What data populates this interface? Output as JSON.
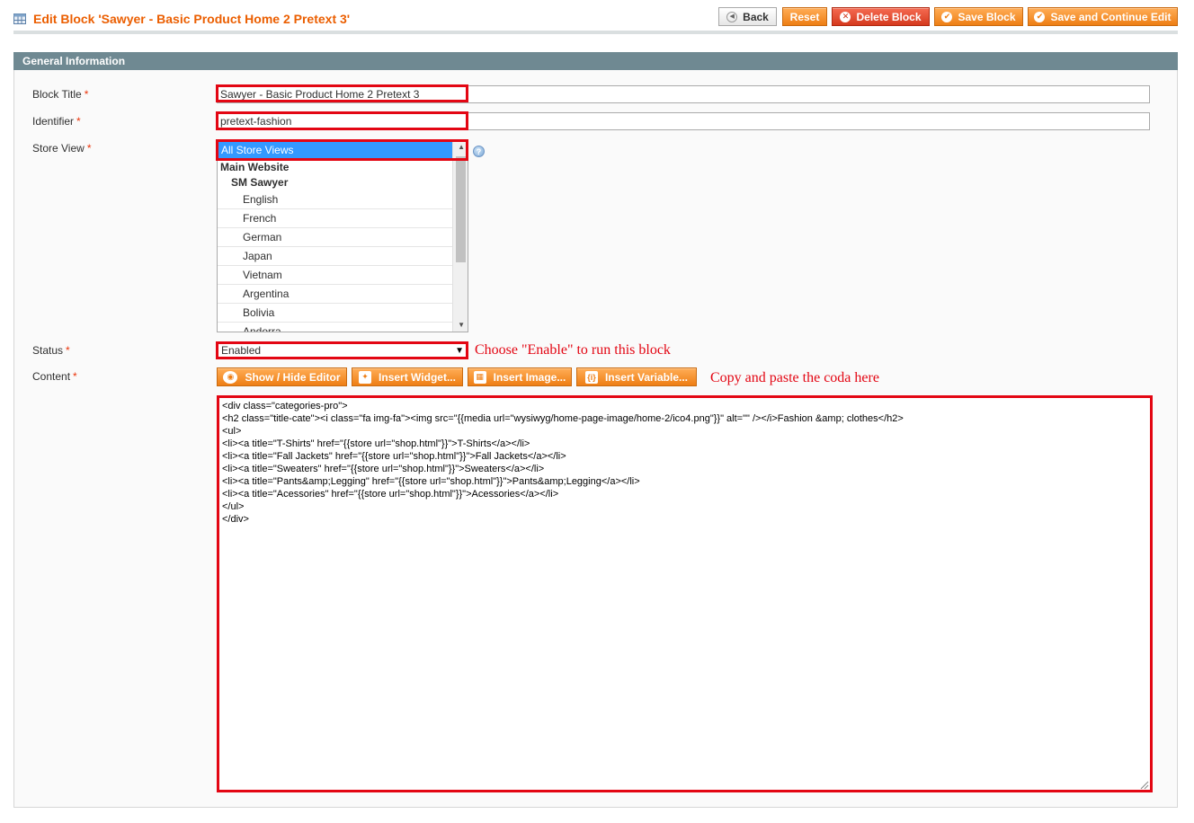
{
  "header": {
    "title": "Edit Block 'Sawyer - Basic Product Home 2 Pretext 3'",
    "buttons": {
      "back": "Back",
      "reset": "Reset",
      "delete": "Delete Block",
      "save": "Save Block",
      "save_continue": "Save and Continue Edit"
    }
  },
  "section": {
    "title": "General Information"
  },
  "form": {
    "block_title": {
      "label": "Block Title",
      "required": "*",
      "value": "Sawyer - Basic Product Home 2 Pretext 3"
    },
    "identifier": {
      "label": "Identifier",
      "required": "*",
      "value": "pretext-fashion"
    },
    "store_view": {
      "label": "Store View",
      "required": "*",
      "selected": "All Store Views",
      "group": "Main Website",
      "store": "SM Sawyer",
      "options": [
        "English",
        "French",
        "German",
        "Japan",
        "Vietnam",
        "Argentina",
        "Bolivia",
        "Andorra"
      ]
    },
    "status": {
      "label": "Status",
      "required": "*",
      "value": "Enabled"
    },
    "content": {
      "label": "Content",
      "required": "*",
      "buttons": {
        "toggle": "Show / Hide Editor",
        "widget": "Insert Widget...",
        "image": "Insert Image...",
        "variable": "Insert Variable..."
      },
      "value": "<div class=\"categories-pro\">\n<h2 class=\"title-cate\"><i class=\"fa img-fa\"><img src=\"{{media url=\"wysiwyg/home-page-image/home-2/ico4.png\"}}\" alt=\"\" /></i>Fashion &amp; clothes</h2>\n<ul>\n<li><a title=\"T-Shirts\" href=\"{{store url=\"shop.html\"}}\">T-Shirts</a></li>\n<li><a title=\"Fall Jackets\" href=\"{{store url=\"shop.html\"}}\">Fall Jackets</a></li>\n<li><a title=\"Sweaters\" href=\"{{store url=\"shop.html\"}}\">Sweaters</a></li>\n<li><a title=\"Pants&amp;Legging\" href=\"{{store url=\"shop.html\"}}\">Pants&amp;Legging</a></li>\n<li><a title=\"Acessories\" href=\"{{store url=\"shop.html\"}}\">Acessories</a></li>\n</ul>\n</div>"
    }
  },
  "annotations": {
    "status_note": "Choose \"Enable\" to run this block",
    "content_note": "Copy and paste the coda here"
  },
  "colors": {
    "accent_orange": "#eb5e00",
    "highlight_red": "#e30613",
    "section_header": "#6f8992",
    "selection_blue": "#3399ff"
  },
  "icons": {
    "title": "grid-table-icon",
    "back": "back-arrow-icon",
    "delete": "delete-circle-icon",
    "save": "checkmark-icon",
    "toggle": "eye-icon",
    "widget": "widget-icon",
    "image": "image-icon",
    "variable": "variable-icon",
    "help": "help-icon"
  }
}
